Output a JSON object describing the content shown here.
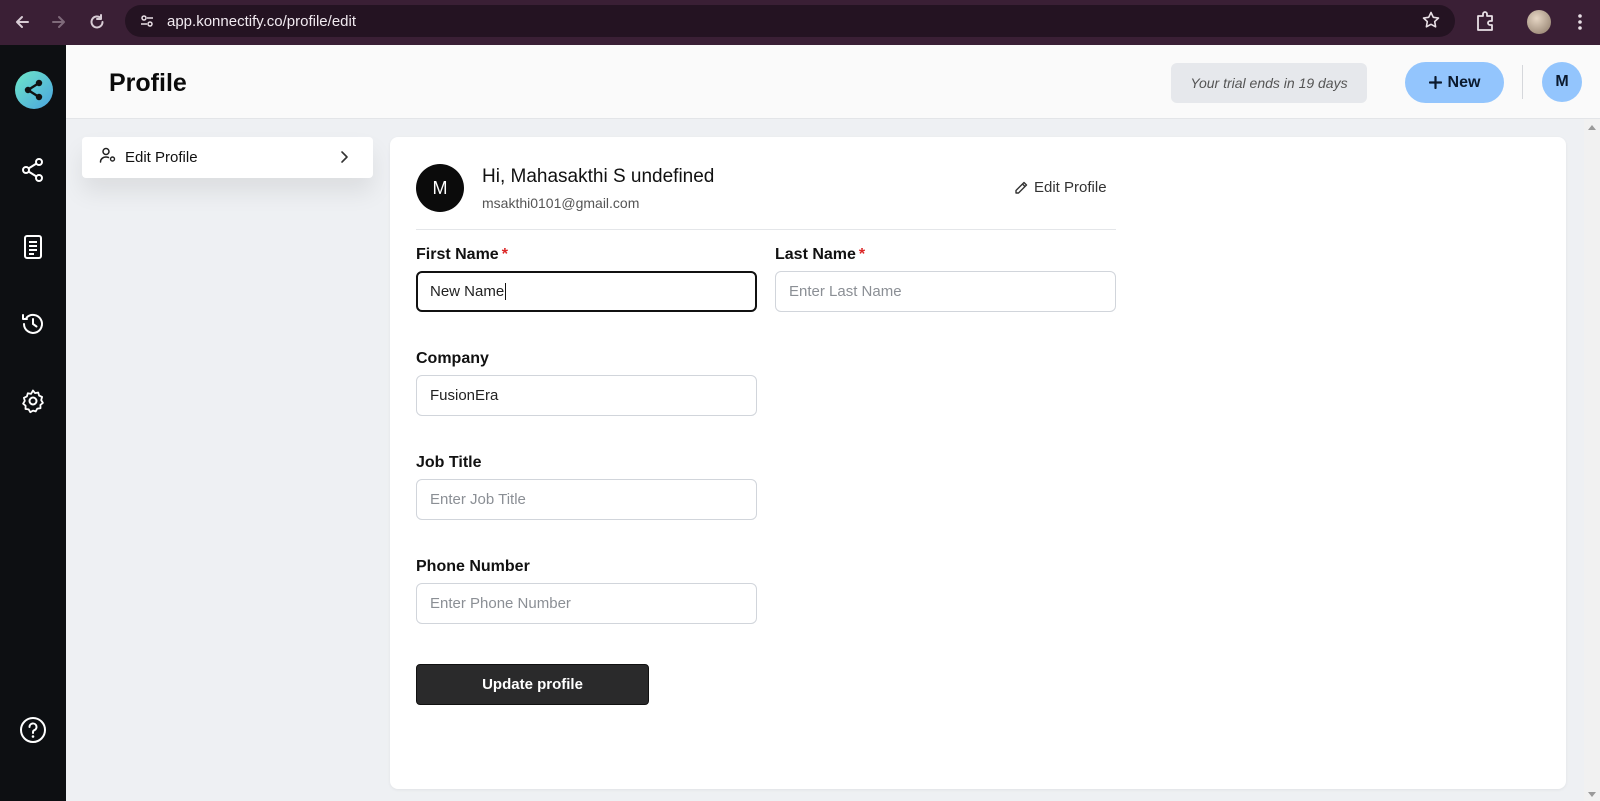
{
  "browser": {
    "url": "app.konnectify.co/profile/edit"
  },
  "rail": {
    "items": [
      {
        "name": "connections-icon"
      },
      {
        "name": "document-icon"
      },
      {
        "name": "history-icon"
      },
      {
        "name": "settings-icon"
      },
      {
        "name": "help-icon"
      }
    ]
  },
  "header": {
    "title": "Profile",
    "trial_text": "Your trial ends in 19 days",
    "new_label": "New",
    "avatar_initial": "M"
  },
  "sidemenu": {
    "edit_profile_label": "Edit Profile"
  },
  "profile": {
    "avatar_initial": "M",
    "greeting": "Hi, Mahasakthi S undefined",
    "email": "msakthi0101@gmail.com",
    "edit_link": "Edit Profile"
  },
  "form": {
    "first_name": {
      "label": "First Name",
      "required_mark": "*",
      "value": "New Name"
    },
    "last_name": {
      "label": "Last Name",
      "required_mark": "*",
      "placeholder": "Enter Last Name"
    },
    "company": {
      "label": "Company",
      "value": "FusionEra"
    },
    "job_title": {
      "label": "Job Title",
      "placeholder": "Enter Job Title"
    },
    "phone": {
      "label": "Phone Number",
      "placeholder": "Enter Phone Number"
    },
    "submit_label": "Update profile"
  },
  "colors": {
    "chrome_bg": "#3a1f35",
    "rail_bg": "#0d0f12",
    "accent_blue": "#93c5fd",
    "button_dark": "#2a2a2b",
    "required_red": "#dc2626"
  }
}
